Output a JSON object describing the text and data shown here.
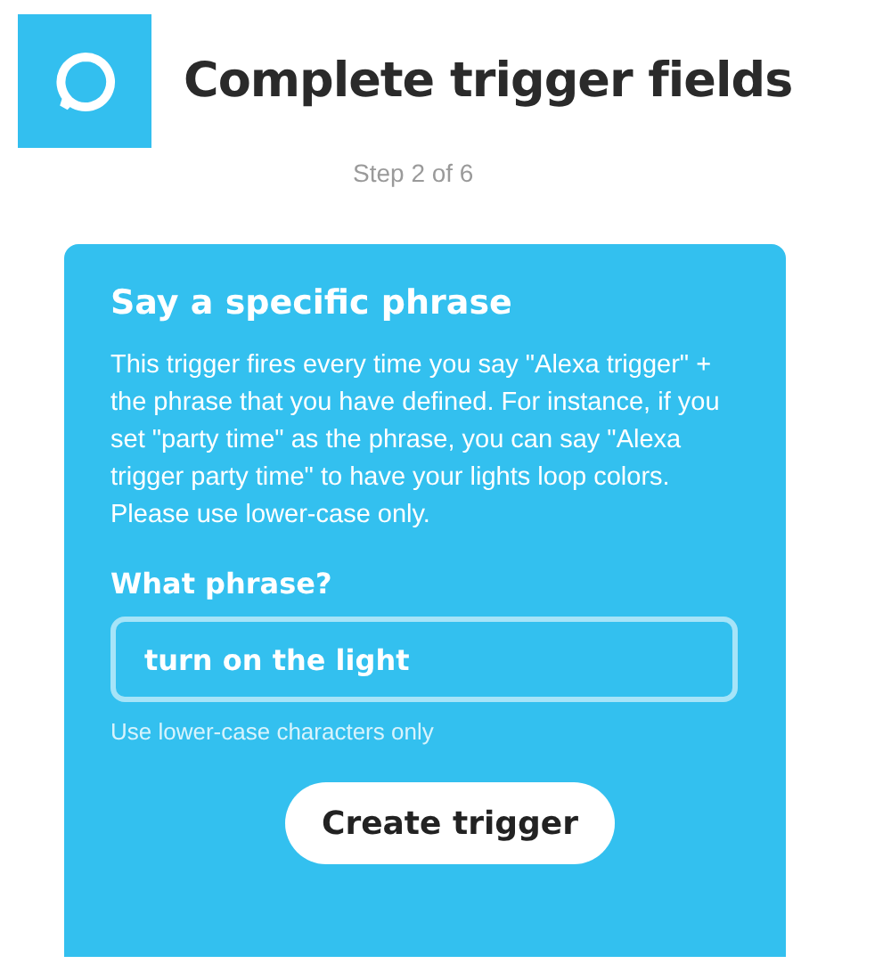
{
  "header": {
    "title": "Complete trigger fields",
    "step": "Step 2 of 6"
  },
  "card": {
    "heading": "Say a specific phrase",
    "description": "This trigger fires every time you say \"Alexa trigger\" + the phrase that you have defined. For instance, if you set \"party time\" as the phrase, you can say \"Alexa trigger party time\" to have your lights loop colors. Please use lower-case only.",
    "field": {
      "label": "What phrase?",
      "value": "turn on the light",
      "hint": "Use lower-case characters only"
    },
    "button": "Create trigger"
  }
}
